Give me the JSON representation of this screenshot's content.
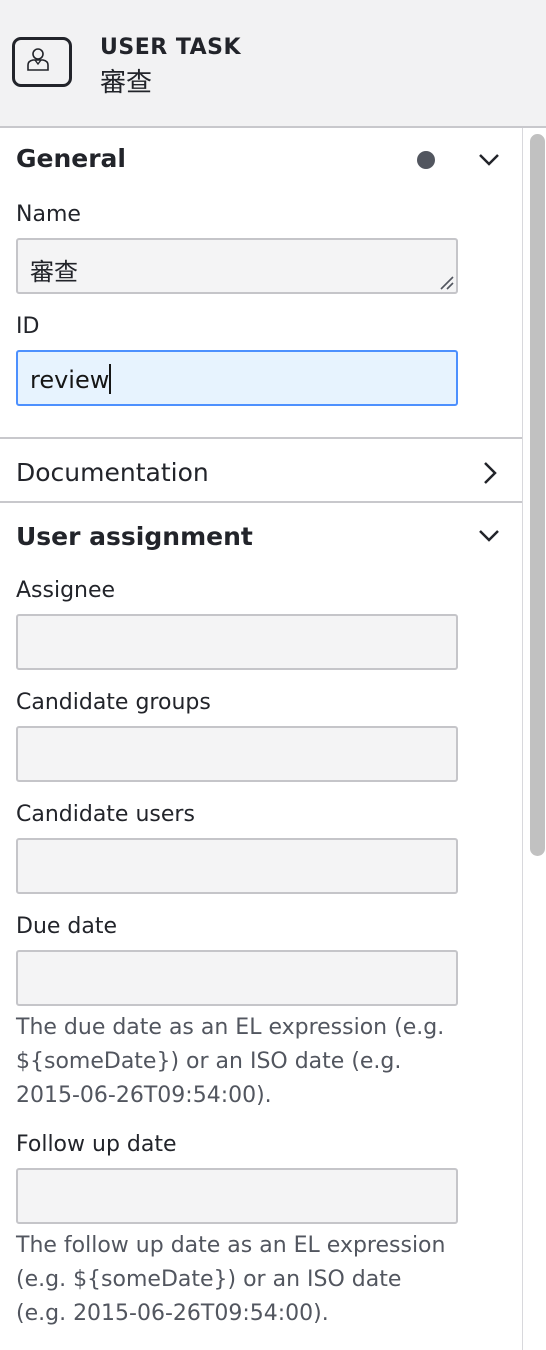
{
  "header": {
    "type_label": "USER TASK",
    "element_name": "審查",
    "icon": "user-task-icon"
  },
  "groups": {
    "general": {
      "title": "General",
      "name_label": "Name",
      "name_value": "審查",
      "id_label": "ID",
      "id_value": "review"
    },
    "documentation": {
      "title": "Documentation"
    },
    "user_assignment": {
      "title": "User assignment",
      "assignee_label": "Assignee",
      "assignee_value": "",
      "candidate_groups_label": "Candidate groups",
      "candidate_groups_value": "",
      "candidate_users_label": "Candidate users",
      "candidate_users_value": "",
      "due_date_label": "Due date",
      "due_date_value": "",
      "due_date_desc": "The due date as an EL expression (e.g. ${someDate}) or an ISO date (e.g. 2015-06-26T09:54:00).",
      "follow_up_label": "Follow up date",
      "follow_up_value": "",
      "follow_up_desc": "The follow up date as an EL expression (e.g. ${someDate}) or an ISO date (e.g. 2015-06-26T09:54:00)."
    }
  },
  "icons": [
    "user-task-icon",
    "chevron-down-icon",
    "chevron-right-icon",
    "resize-grip-icon",
    "changed-indicator-dot"
  ]
}
